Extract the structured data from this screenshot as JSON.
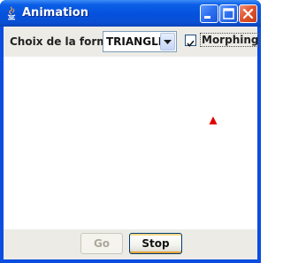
{
  "window": {
    "title": "Animation",
    "icons": [
      "java-app-icon",
      "minimize-icon",
      "maximize-icon",
      "close-icon"
    ]
  },
  "toolbar": {
    "shape_label": "Choix de la forme",
    "shape_select": {
      "selected": "TRIANGLE",
      "icon": "chevron-down-icon"
    },
    "morphing": {
      "label": "Morphing",
      "checked": true
    }
  },
  "canvas": {
    "shape": "triangle",
    "shape_color": "#e00000"
  },
  "buttons": {
    "go": {
      "label": "Go",
      "enabled": false
    },
    "stop": {
      "label": "Stop",
      "enabled": true
    }
  },
  "colors": {
    "titlebar": "#0551dd",
    "panel": "#ecebe6",
    "canvas": "#ffffff",
    "close_button": "#e1562f"
  }
}
